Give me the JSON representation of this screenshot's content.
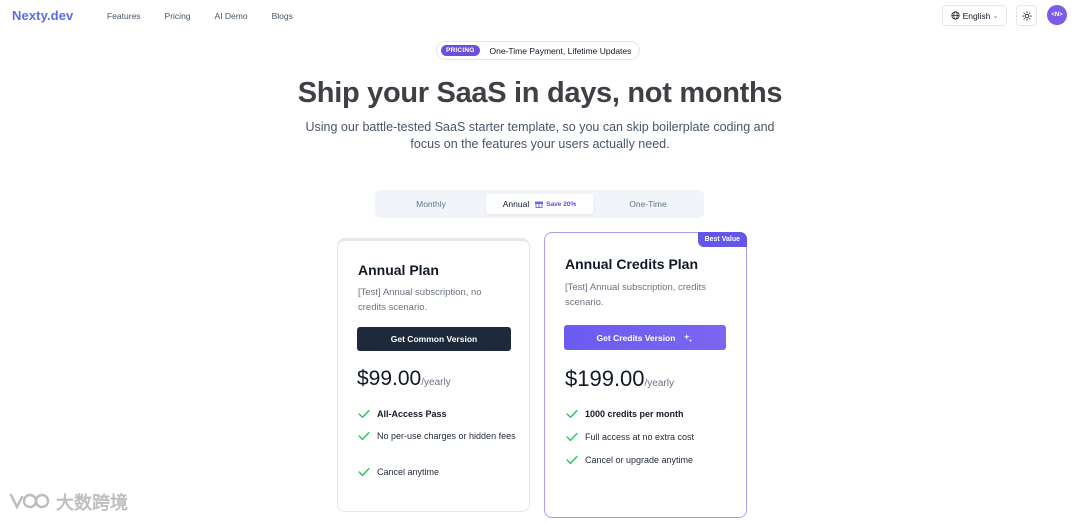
{
  "nav": {
    "logo": "Nexty.dev",
    "links": [
      "Features",
      "Pricing",
      "AI Demo",
      "Blogs"
    ],
    "language": "English",
    "avatar": "<N>"
  },
  "hero": {
    "pill_tag": "PRICING",
    "pill_text": "One-Time Payment, Lifetime Updates",
    "title": "Ship your SaaS in days, not months",
    "subtitle": "Using our battle-tested SaaS starter template, so you can skip boilerplate coding and focus on the features your users actually need."
  },
  "billing_toggle": {
    "options": [
      "Monthly",
      "Annual",
      "One-Time"
    ],
    "selected": "Annual",
    "save_badge": "Save 20%"
  },
  "plans": [
    {
      "title": "Annual Plan",
      "description": "[Test] Annual subscription, no credits scenario.",
      "cta": "Get Common Version",
      "price": "$99.00",
      "unit": "/yearly",
      "features": [
        "All-Access Pass",
        "No per-use charges or hidden fees",
        "Cancel anytime"
      ]
    },
    {
      "badge": "Best Value",
      "title": "Annual Credits Plan",
      "description": "[Test] Annual subscription, credits scenario.",
      "cta": "Get Credits Version",
      "price": "$199.00",
      "unit": "/yearly",
      "features": [
        "1000 credits per month",
        "Full access at no extra cost",
        "Cancel or upgrade anytime"
      ]
    }
  ],
  "watermark": {
    "text": "大数跨境"
  },
  "colors": {
    "brand": "#5b6ee8",
    "accent": "#6357e8",
    "check": "#22c55e",
    "dark_button": "#1e293b"
  },
  "icons": [
    "globe-icon",
    "chevron-down-icon",
    "sun-icon",
    "gift-icon",
    "sparkle-icon",
    "check-icon"
  ]
}
